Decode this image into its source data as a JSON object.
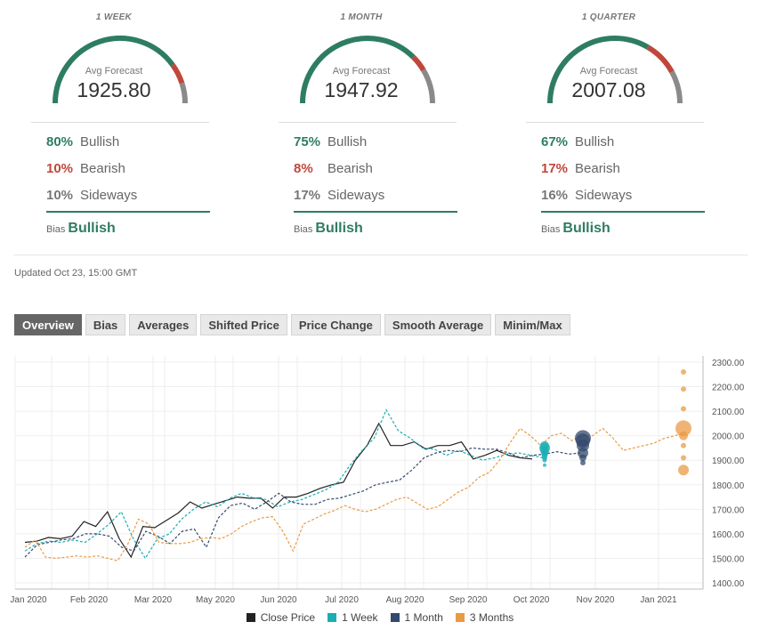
{
  "gauges": [
    {
      "title": "1 WEEK",
      "label": "Avg Forecast",
      "value": "1925.80",
      "bullish_pct": "80%",
      "bullish": "Bullish",
      "bearish_pct": "10%",
      "bearish": "Bearish",
      "sideways_pct": "10%",
      "sideways": "Sideways",
      "bias_label": "Bias",
      "bias": "Bullish",
      "segments": {
        "green": 0.8,
        "red": 0.1,
        "grey": 0.1
      }
    },
    {
      "title": "1 MONTH",
      "label": "Avg Forecast",
      "value": "1947.92",
      "bullish_pct": "75%",
      "bullish": "Bullish",
      "bearish_pct": "8%",
      "bearish": "Bearish",
      "sideways_pct": "17%",
      "sideways": "Sideways",
      "bias_label": "Bias",
      "bias": "Bullish",
      "segments": {
        "green": 0.75,
        "red": 0.08,
        "grey": 0.17
      }
    },
    {
      "title": "1 QUARTER",
      "label": "Avg Forecast",
      "value": "2007.08",
      "bullish_pct": "67%",
      "bullish": "Bullish",
      "bearish_pct": "17%",
      "bearish": "Bearish",
      "sideways_pct": "16%",
      "sideways": "Sideways",
      "bias_label": "Bias",
      "bias": "Bullish",
      "segments": {
        "green": 0.67,
        "red": 0.17,
        "grey": 0.16
      }
    }
  ],
  "colors": {
    "bullish": "#2e7d62",
    "bearish": "#c0473b",
    "sideways": "#8a8a8a",
    "close": "#222222",
    "week": "#1aaeb4",
    "month": "#34496e",
    "quarter": "#e99b44"
  },
  "updated": "Updated Oct 23, 15:00 GMT",
  "tabs": [
    "Overview",
    "Bias",
    "Averages",
    "Shifted Price",
    "Price Change",
    "Smooth Average",
    "Minim/Max"
  ],
  "active_tab": "Overview",
  "chart_data": {
    "type": "line",
    "x_labels": [
      "Jan 2020",
      "Feb 2020",
      "Mar 2020",
      "May 2020",
      "Jun 2020",
      "Jul 2020",
      "Aug 2020",
      "Sep 2020",
      "Oct 2020",
      "Nov 2020",
      "Jan 2021"
    ],
    "y_ticks": [
      "2300.00",
      "2200.00",
      "2100.00",
      "2000.00",
      "1900.00",
      "1800.00",
      "1700.00",
      "1600.00",
      "1500.00",
      "1400.00"
    ],
    "ylim": [
      1400,
      2300
    ],
    "legend": [
      "Close Price",
      "1 Week",
      "1 Month",
      "3 Months"
    ],
    "series": [
      {
        "name": "Close Price",
        "values": [
          1565,
          1570,
          1585,
          1580,
          1590,
          1650,
          1630,
          1690,
          1580,
          1505,
          1630,
          1625,
          1655,
          1685,
          1730,
          1705,
          1720,
          1735,
          1750,
          1745,
          1745,
          1705,
          1750,
          1750,
          1765,
          1785,
          1800,
          1810,
          1900,
          1960,
          2050,
          1960,
          1960,
          1975,
          1945,
          1960,
          1960,
          1975,
          1905,
          1920,
          1940,
          1920,
          1910,
          1905
        ]
      },
      {
        "name": "1 Week",
        "values": [
          1530,
          1560,
          1570,
          1565,
          1575,
          1565,
          1600,
          1640,
          1690,
          1580,
          1500,
          1580,
          1600,
          1660,
          1700,
          1730,
          1710,
          1745,
          1765,
          1745,
          1740,
          1710,
          1730,
          1740,
          1760,
          1780,
          1810,
          1880,
          1940,
          1990,
          2105,
          2020,
          1990,
          1950,
          1945,
          1920,
          1940,
          1920,
          1900,
          1910,
          1925,
          1930,
          1920,
          1910
        ]
      },
      {
        "name": "1 Month",
        "values": [
          1505,
          1555,
          1565,
          1575,
          1580,
          1600,
          1600,
          1590,
          1545,
          1530,
          1610,
          1590,
          1560,
          1610,
          1620,
          1545,
          1665,
          1715,
          1725,
          1700,
          1730,
          1765,
          1730,
          1720,
          1720,
          1740,
          1745,
          1760,
          1775,
          1800,
          1810,
          1820,
          1860,
          1910,
          1930,
          1940,
          1935,
          1950,
          1945,
          1945,
          1930,
          1910,
          1920,
          1925,
          1935,
          1925,
          1930
        ]
      },
      {
        "name": "3 Months",
        "values": [
          1545,
          1575,
          1505,
          1500,
          1505,
          1510,
          1505,
          1510,
          1500,
          1490,
          1560,
          1660,
          1640,
          1565,
          1560,
          1560,
          1565,
          1580,
          1585,
          1580,
          1600,
          1630,
          1650,
          1665,
          1670,
          1610,
          1530,
          1640,
          1660,
          1680,
          1695,
          1715,
          1700,
          1690,
          1700,
          1720,
          1740,
          1750,
          1725,
          1700,
          1710,
          1740,
          1770,
          1790,
          1830,
          1850,
          1900,
          1970,
          2030,
          2000,
          1960,
          2000,
          2010,
          1980,
          2000,
          2000,
          2030,
          1990,
          1940,
          1950,
          1960,
          1970,
          1990,
          2000,
          2015
        ]
      }
    ],
    "forecast_points": {
      "week": [
        1960,
        1950,
        1940,
        1930,
        1920,
        1910,
        1900,
        1880
      ],
      "month": [
        1990,
        1980,
        1960,
        1930,
        1910,
        1890
      ],
      "quarter": [
        2260,
        2190,
        2110,
        2030,
        2000,
        1960,
        1910,
        1860
      ]
    }
  }
}
